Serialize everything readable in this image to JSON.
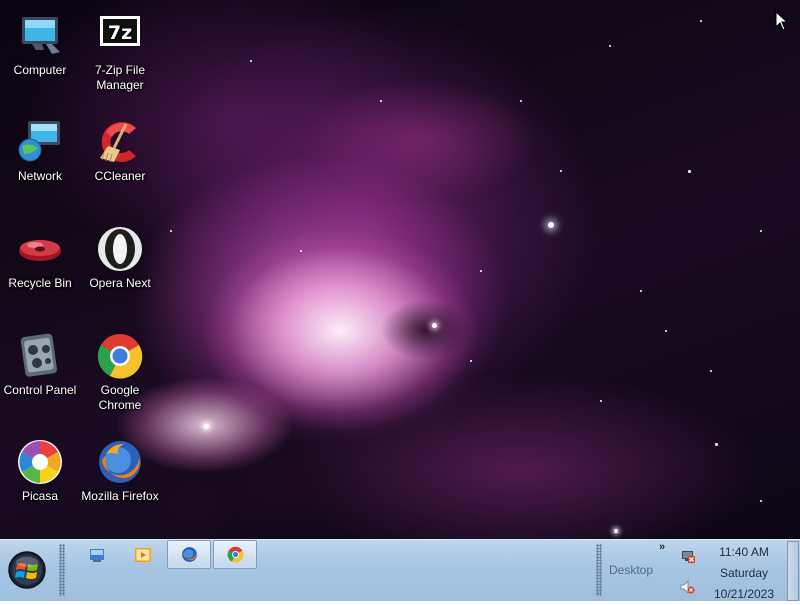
{
  "desktop": {
    "icons": [
      {
        "label": "Computer",
        "icon": "computer-icon"
      },
      {
        "label": "7-Zip File Manager",
        "icon": "7zip-icon",
        "glyph_text": "7z"
      },
      {
        "label": "Network",
        "icon": "network-icon"
      },
      {
        "label": "CCleaner",
        "icon": "ccleaner-icon"
      },
      {
        "label": "Recycle Bin",
        "icon": "recycle-bin-icon"
      },
      {
        "label": "Opera Next",
        "icon": "opera-icon"
      },
      {
        "label": "Control Panel",
        "icon": "control-panel-icon"
      },
      {
        "label": "Google Chrome",
        "icon": "chrome-icon"
      },
      {
        "label": "Picasa",
        "icon": "picasa-icon"
      },
      {
        "label": "Mozilla Firefox",
        "icon": "firefox-icon"
      }
    ]
  },
  "taskbar": {
    "start_icon": "windows-start-orb-icon",
    "quick_launch": [
      {
        "icon": "show-desktop-quick-icon"
      },
      {
        "icon": "media-player-icon"
      }
    ],
    "tasks": [
      {
        "icon": "firefox-icon"
      },
      {
        "icon": "chrome-icon"
      }
    ],
    "toolbar_label": "Desktop",
    "tray": {
      "chevron": "»",
      "icons": [
        "network-disconnected-icon",
        "volume-muted-icon"
      ]
    },
    "clock": {
      "time": "11:40 AM",
      "day": "Saturday",
      "date": "10/21/2023"
    }
  },
  "colors": {
    "taskbar": "#a8c6e3",
    "icon_text": "#ffffff"
  }
}
